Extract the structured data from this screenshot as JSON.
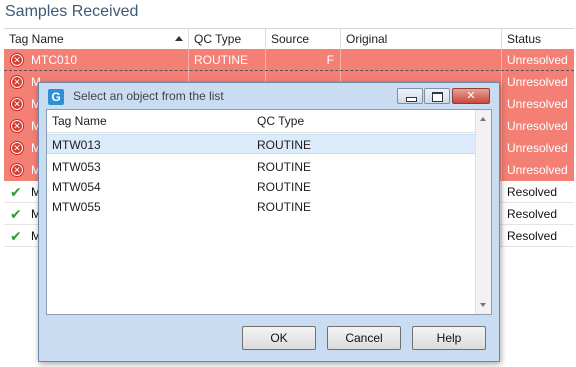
{
  "page": {
    "title": "Samples Received"
  },
  "grid": {
    "columns": [
      "Tag Name",
      "QC Type",
      "Source",
      "Original",
      "Status"
    ],
    "rows": [
      {
        "tag": "MTC010",
        "qc": "ROUTINE",
        "source": "F",
        "original": "",
        "status": "Unresolved",
        "state": "error"
      },
      {
        "tag": "M",
        "qc": "",
        "source": "",
        "original": "",
        "status": "Unresolved",
        "state": "error"
      },
      {
        "tag": "M",
        "qc": "",
        "source": "",
        "original": "",
        "status": "Unresolved",
        "state": "error"
      },
      {
        "tag": "M",
        "qc": "",
        "source": "",
        "original": "",
        "status": "Unresolved",
        "state": "error"
      },
      {
        "tag": "M",
        "qc": "",
        "source": "",
        "original": "",
        "status": "Unresolved",
        "state": "error"
      },
      {
        "tag": "M",
        "qc": "",
        "source": "",
        "original": "",
        "status": "Unresolved",
        "state": "error"
      },
      {
        "tag": "M",
        "qc": "",
        "source": "",
        "original": "",
        "status": "Resolved",
        "state": "ok"
      },
      {
        "tag": "M",
        "qc": "",
        "source": "",
        "original": "",
        "status": "Resolved",
        "state": "ok"
      },
      {
        "tag": "M",
        "qc": "",
        "source": "",
        "original": "",
        "status": "Resolved",
        "state": "ok"
      }
    ]
  },
  "dialog": {
    "app_icon": "G",
    "title": "Select an object from the list",
    "columns": [
      "Tag Name",
      "QC Type"
    ],
    "items": [
      {
        "tag": "MTW013",
        "qc": "ROUTINE",
        "selected": true
      },
      {
        "tag": "MTW053",
        "qc": "ROUTINE",
        "selected": false
      },
      {
        "tag": "MTW054",
        "qc": "ROUTINE",
        "selected": false
      },
      {
        "tag": "MTW055",
        "qc": "ROUTINE",
        "selected": false
      }
    ],
    "buttons": {
      "ok": "OK",
      "cancel": "Cancel",
      "help": "Help"
    }
  },
  "colors": {
    "error_row": "#f47f74",
    "selected_row": "#dcebfa",
    "dialog_frame": "#c9dcf1",
    "title_text": "#3c5a78"
  }
}
